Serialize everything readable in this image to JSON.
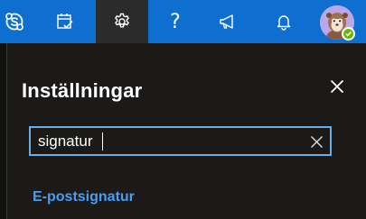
{
  "topbar": {
    "icons": [
      "skype-icon",
      "calendar-check-icon",
      "gear-icon",
      "question-icon",
      "megaphone-icon",
      "bell-icon"
    ],
    "help_label": "?",
    "accent_color": "#0e6fd1",
    "active_item": "settings"
  },
  "user": {
    "avatar": "avatar-icon",
    "presence": "available"
  },
  "panel": {
    "title": "Inställningar",
    "close_icon": "close-icon"
  },
  "search": {
    "value": "signatur",
    "clear_icon": "close-icon"
  },
  "results": [
    {
      "label": "E-postsignatur"
    }
  ]
}
